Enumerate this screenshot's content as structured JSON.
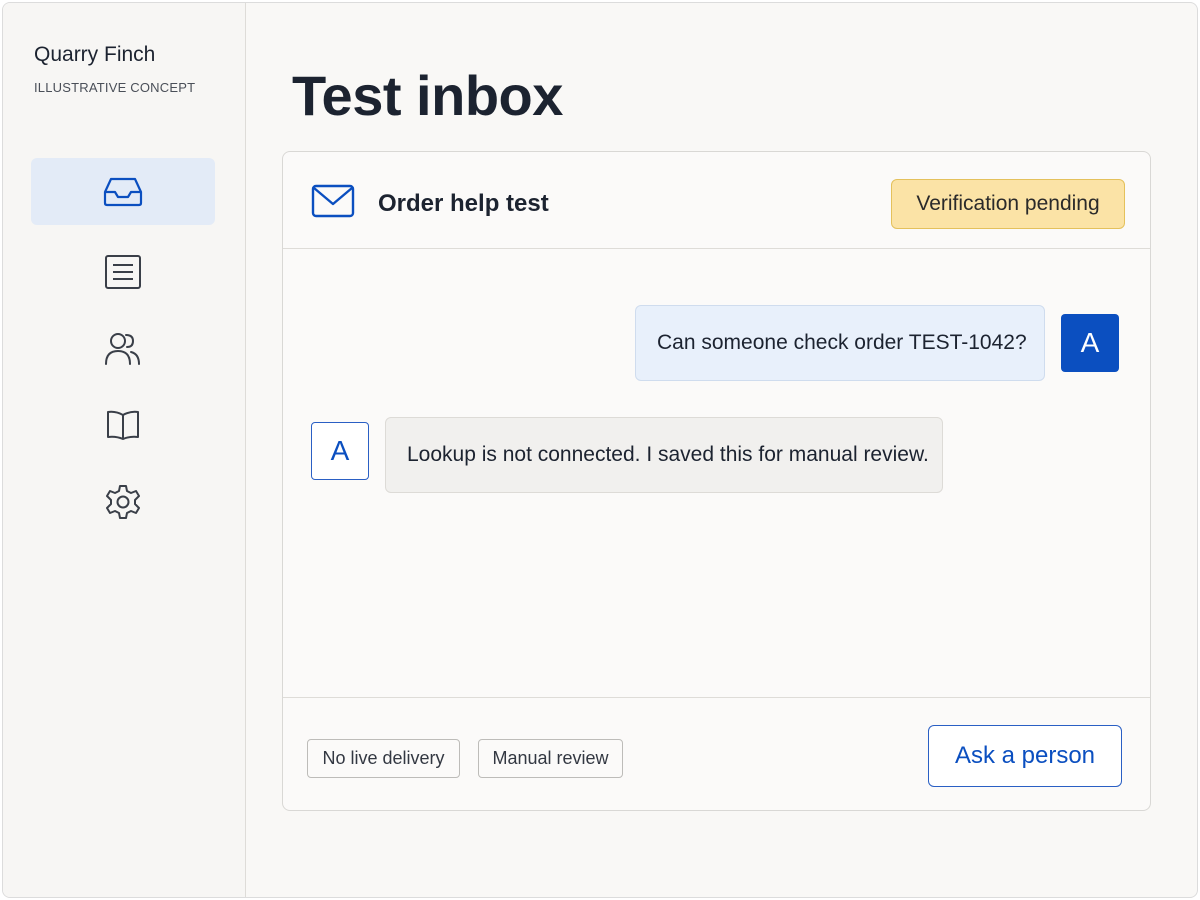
{
  "sidebar": {
    "brand_name": "Quarry Finch",
    "brand_subtitle": "ILLUSTRATIVE CONCEPT",
    "items": [
      {
        "icon": "inbox-icon",
        "active": true
      },
      {
        "icon": "list-icon",
        "active": false
      },
      {
        "icon": "users-icon",
        "active": false
      },
      {
        "icon": "book-icon",
        "active": false
      },
      {
        "icon": "gear-icon",
        "active": false
      }
    ]
  },
  "main": {
    "title": "Test inbox",
    "thread": {
      "icon": "mail-icon",
      "title": "Order help test",
      "status": "Verification pending",
      "messages": [
        {
          "text": "Can someone check order TEST-1042?",
          "avatar": "A",
          "side": "right"
        },
        {
          "text": "Lookup is not connected. I saved this for manual review.",
          "avatar": "A",
          "side": "left"
        }
      ],
      "tags": [
        "No live delivery",
        "Manual review"
      ],
      "action_label": "Ask a person"
    }
  },
  "colors": {
    "accent": "#0b4fc0",
    "badge_bg": "#fbe3a6",
    "active_nav_bg": "#e3ebf7",
    "outgoing_bubble_bg": "#e8f0fb",
    "incoming_bubble_bg": "#f1f0ee"
  }
}
